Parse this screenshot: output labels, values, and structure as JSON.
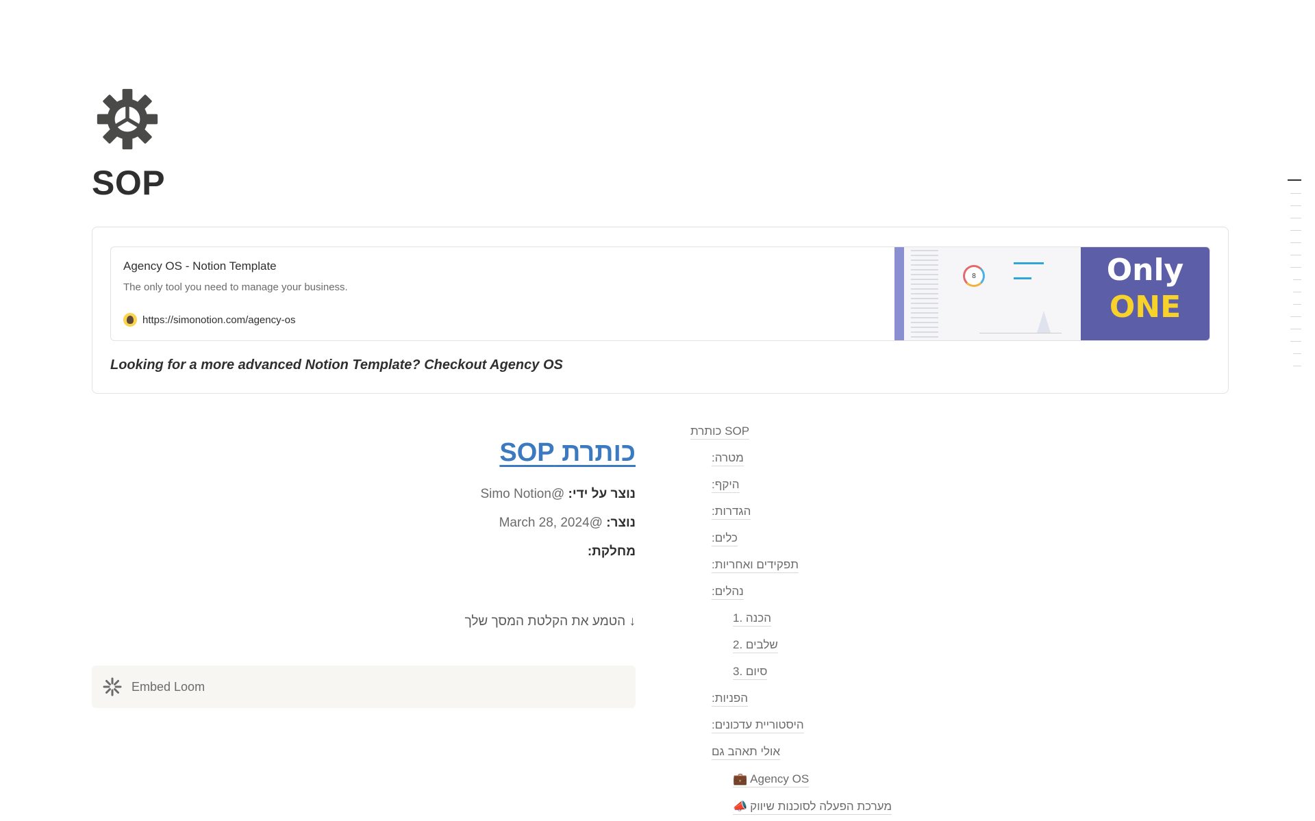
{
  "page": {
    "icon": "gear-icon",
    "title": "SOP"
  },
  "callout": {
    "bookmark": {
      "title": "Agency OS - Notion Template",
      "description": "The only tool you need to manage your business.",
      "url": "https://simonotion.com/agency-os",
      "favicon": "avatar-favicon-icon",
      "cover": {
        "ring_value": "8",
        "promo_line_1": "Only",
        "promo_line_2": "ONE"
      }
    },
    "text": "Looking for a more advanced Notion Template? Checkout Agency OS"
  },
  "doc": {
    "heading": "כותרת SOP",
    "created_by_label": "נוצר על ידי:",
    "created_by_value": "@Simo Notion",
    "created_label": "נוצר:",
    "created_value": "@March 28, 2024",
    "department_label": "מחלקת:",
    "embed_hint": "↓ הטמע את הקלטת המסך שלך",
    "embed_label": "Embed Loom"
  },
  "toc": [
    {
      "label": "כותרת SOP",
      "level": 1
    },
    {
      "label": "מטרה:",
      "level": 2
    },
    {
      "label": "היקף:",
      "level": 2
    },
    {
      "label": "הגדרות:",
      "level": 2
    },
    {
      "label": "כלים:",
      "level": 2
    },
    {
      "label": "תפקידים ואחריות:",
      "level": 2
    },
    {
      "label": "נהלים:",
      "level": 2
    },
    {
      "label": "1. הכנה",
      "level": 3
    },
    {
      "label": "2. שלבים",
      "level": 3
    },
    {
      "label": "3. סיום",
      "level": 3
    },
    {
      "label": "הפניות:",
      "level": 2
    },
    {
      "label": "היסטוריית עדכונים:",
      "level": 2
    },
    {
      "label": "אולי תאהב גם",
      "level": 2
    },
    {
      "label": "Agency OS",
      "level": 3,
      "emoji": "💼"
    },
    {
      "label": "מערכת הפעלה לסוכנות שיווק",
      "level": 3,
      "emoji": "📣"
    }
  ],
  "colors": {
    "link": "#3b7ac1",
    "promo_bg": "#5c5fa8",
    "promo_highlight": "#f7d22a",
    "embed_bg": "#f7f6f3"
  }
}
